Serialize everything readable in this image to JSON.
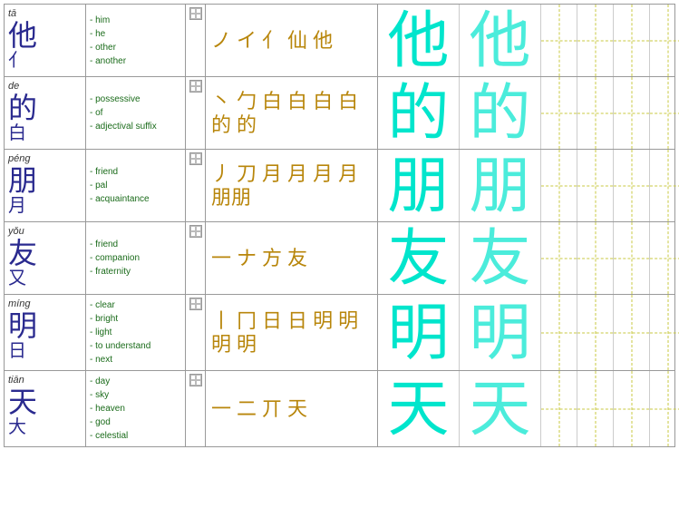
{
  "rows": [
    {
      "id": "ta",
      "pinyin": "tā",
      "char": "他",
      "radical": "亻",
      "meanings": [
        "him",
        "he",
        "other",
        "another"
      ],
      "strokes": [
        "ノ",
        "イ",
        "亻",
        "仙",
        "他"
      ],
      "large1": "他",
      "large2": "他"
    },
    {
      "id": "de",
      "pinyin": "de",
      "char": "的",
      "radical": "白",
      "meanings": [
        "possessive",
        "of",
        "adjectival suffix"
      ],
      "strokes": [
        "丶",
        "勹",
        "白",
        "白",
        "白",
        "白",
        "的",
        "的"
      ],
      "large1": "的",
      "large2": "的"
    },
    {
      "id": "peng",
      "pinyin": "péng",
      "char": "朋",
      "radical": "月",
      "meanings": [
        "friend",
        "pal",
        "acquaintance"
      ],
      "strokes": [
        "丿",
        "刀",
        "月",
        "月",
        "月",
        "月",
        "朋朋"
      ],
      "large1": "朋",
      "large2": "朋"
    },
    {
      "id": "you",
      "pinyin": "yǒu",
      "char": "友",
      "radical": "又",
      "meanings": [
        "friend",
        "companion",
        "fraternity"
      ],
      "strokes": [
        "一",
        "ナ",
        "方",
        "友"
      ],
      "large1": "友",
      "large2": "友"
    },
    {
      "id": "ming",
      "pinyin": "míng",
      "char": "明",
      "radical": "日",
      "meanings": [
        "clear",
        "bright",
        "light",
        "to understand",
        "next"
      ],
      "strokes": [
        "丨",
        "冂",
        "日",
        "日",
        "明",
        "明",
        "明",
        "明"
      ],
      "large1": "明",
      "large2": "明"
    },
    {
      "id": "tian",
      "pinyin": "tiān",
      "char": "天",
      "radical": "大",
      "meanings": [
        "day",
        "sky",
        "heaven",
        "god",
        "celestial"
      ],
      "strokes": [
        "一",
        "二",
        "丌",
        "天"
      ],
      "large1": "天",
      "large2": "天"
    }
  ]
}
